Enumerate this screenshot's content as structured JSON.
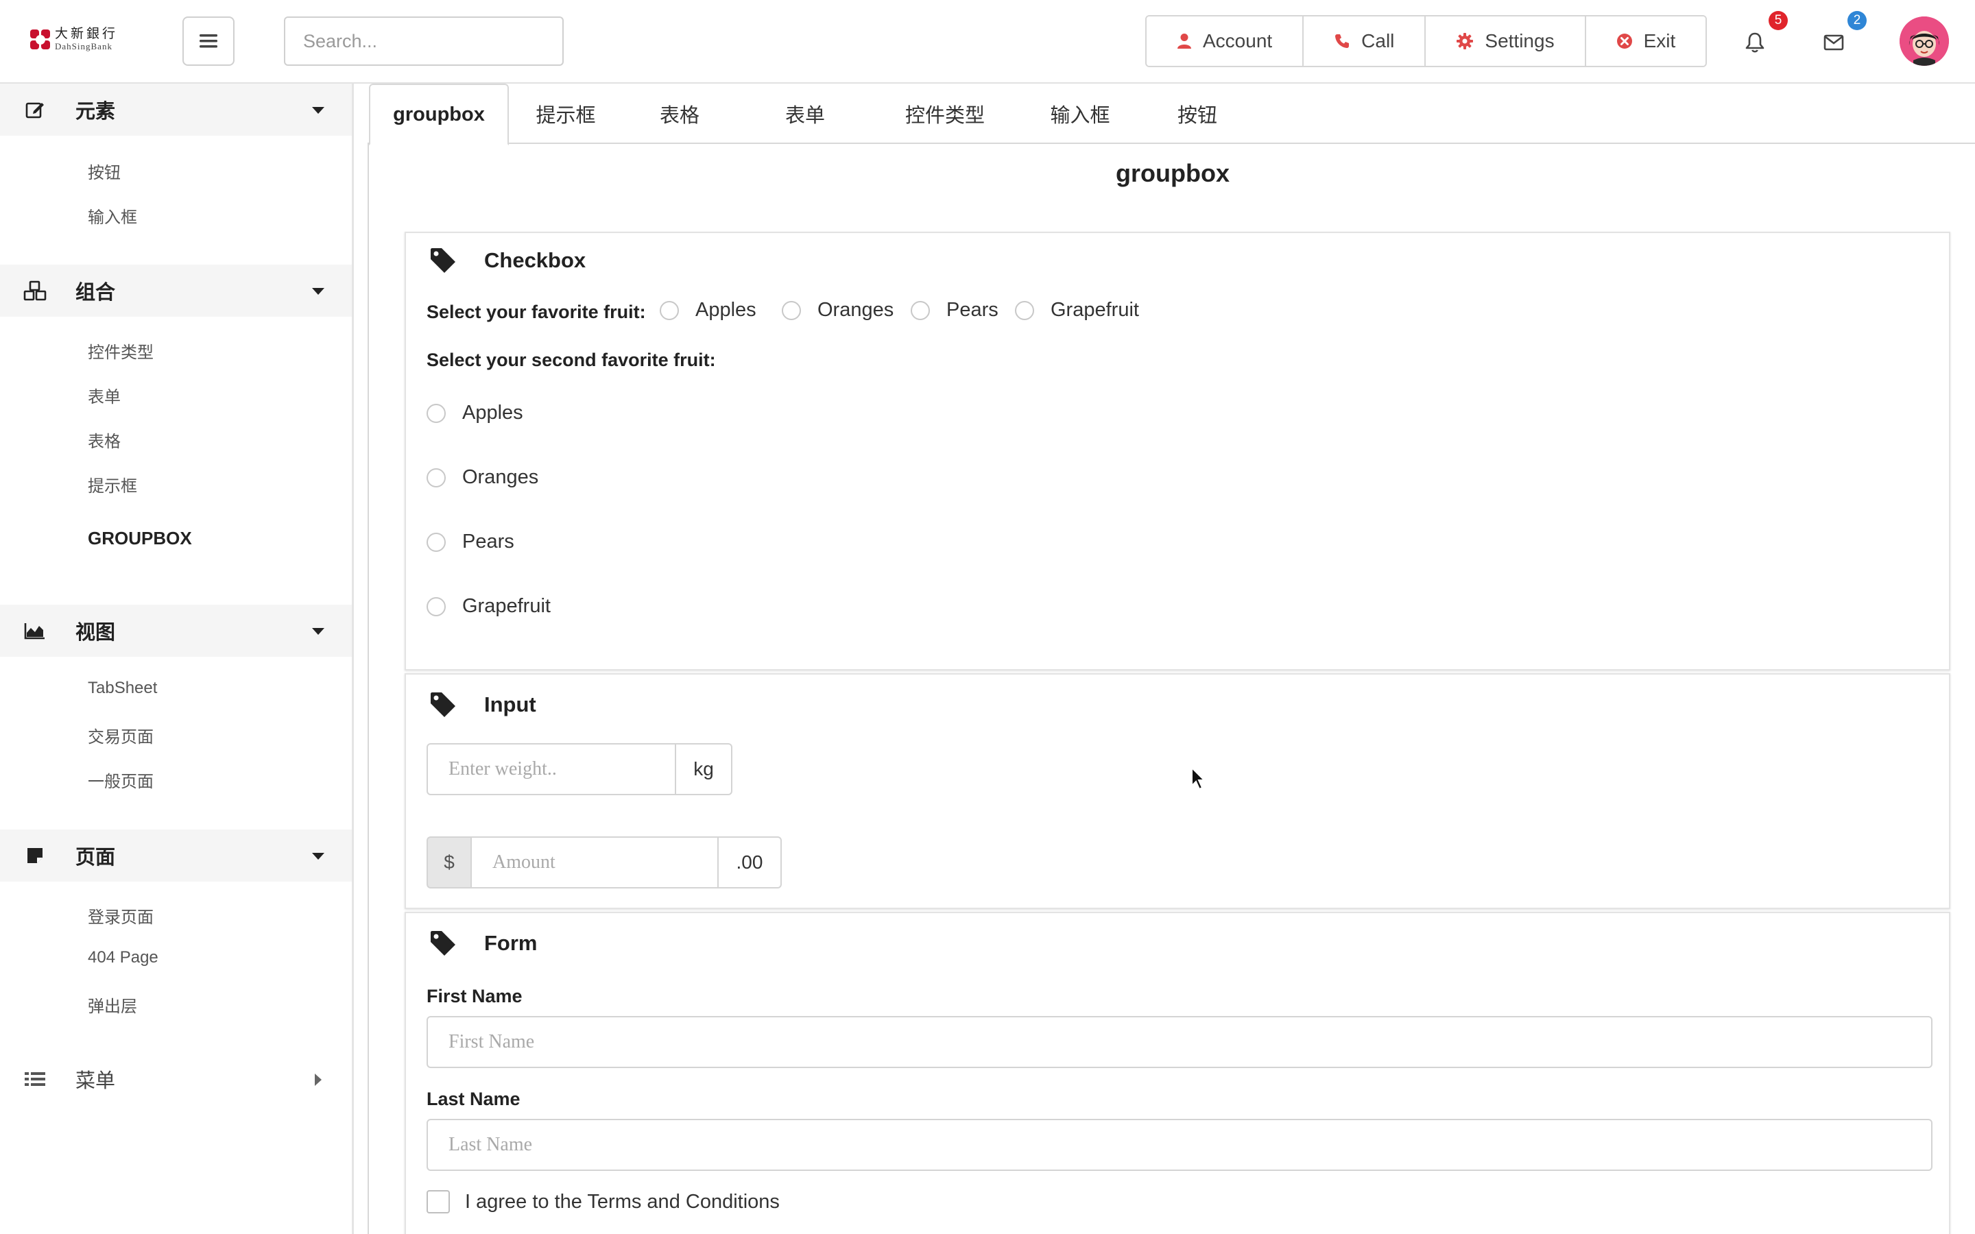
{
  "brand": {
    "name_cn": "大新銀行",
    "name_en": "DahSingBank",
    "color": "#c8102e"
  },
  "header": {
    "search_placeholder": "Search...",
    "buttons": [
      {
        "label": "Account",
        "icon": "user-icon"
      },
      {
        "label": "Call",
        "icon": "phone-icon"
      },
      {
        "label": "Settings",
        "icon": "gear-icon"
      },
      {
        "label": "Exit",
        "icon": "close-circle-icon"
      }
    ],
    "notifications": {
      "count": "5",
      "color": "#e0242b"
    },
    "messages": {
      "count": "2",
      "color": "#2f86d6"
    }
  },
  "sidebar": {
    "sections": [
      {
        "title": "元素",
        "icon": "edit-icon",
        "items": [
          "按钮",
          "输入框"
        ]
      },
      {
        "title": "组合",
        "icon": "cubes-icon",
        "items": [
          "控件类型",
          "表单",
          "表格",
          "提示框",
          "GROUPBOX"
        ]
      },
      {
        "title": "视图",
        "icon": "area-chart-icon",
        "items": [
          "TabSheet",
          "交易页面",
          "一般页面"
        ]
      },
      {
        "title": "页面",
        "icon": "sticky-note-icon",
        "items": [
          "登录页面",
          "404 Page",
          "弹出层"
        ]
      },
      {
        "title": "菜单",
        "icon": "list-icon",
        "items": []
      }
    ],
    "active_item": "GROUPBOX"
  },
  "tabs": [
    "groupbox",
    "提示框",
    "表格",
    "表单",
    "控件类型",
    "输入框",
    "按钮"
  ],
  "active_tab": "groupbox",
  "page_title": "groupbox",
  "checkbox_card": {
    "title": "Checkbox",
    "q1_label": "Select your favorite fruit:",
    "q2_label": "Select your second favorite fruit:",
    "fruits": [
      "Apples",
      "Oranges",
      "Pears",
      "Grapefruit"
    ]
  },
  "input_card": {
    "title": "Input",
    "weight_placeholder": "Enter weight..",
    "weight_unit": "kg",
    "currency": "$",
    "amount_placeholder": "Amount",
    "amount_suffix": ".00"
  },
  "form_card": {
    "title": "Form",
    "first_name_label": "First Name",
    "first_name_placeholder": "First Name",
    "last_name_label": "Last Name",
    "last_name_placeholder": "Last Name",
    "terms_label": "I agree to the Terms and Conditions"
  }
}
